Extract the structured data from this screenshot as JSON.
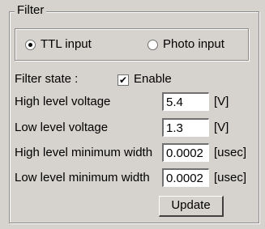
{
  "group": {
    "title": "Filter"
  },
  "input_mode": {
    "ttl_label": "TTL input",
    "photo_label": "Photo input",
    "selected": "ttl"
  },
  "filter_state": {
    "label": "Filter state :",
    "checkbox_label": "Enable",
    "checked": true
  },
  "rows": [
    {
      "label": "High level voltage",
      "value": "5.4",
      "unit": "[V]"
    },
    {
      "label": "Low level voltage",
      "value": "1.3",
      "unit": "[V]"
    },
    {
      "label": "High level minimum width",
      "value": "0.0002",
      "unit": "[usec]"
    },
    {
      "label": "Low level minimum width",
      "value": "0.0002",
      "unit": "[usec]"
    }
  ],
  "update_button": {
    "label": "Update"
  }
}
